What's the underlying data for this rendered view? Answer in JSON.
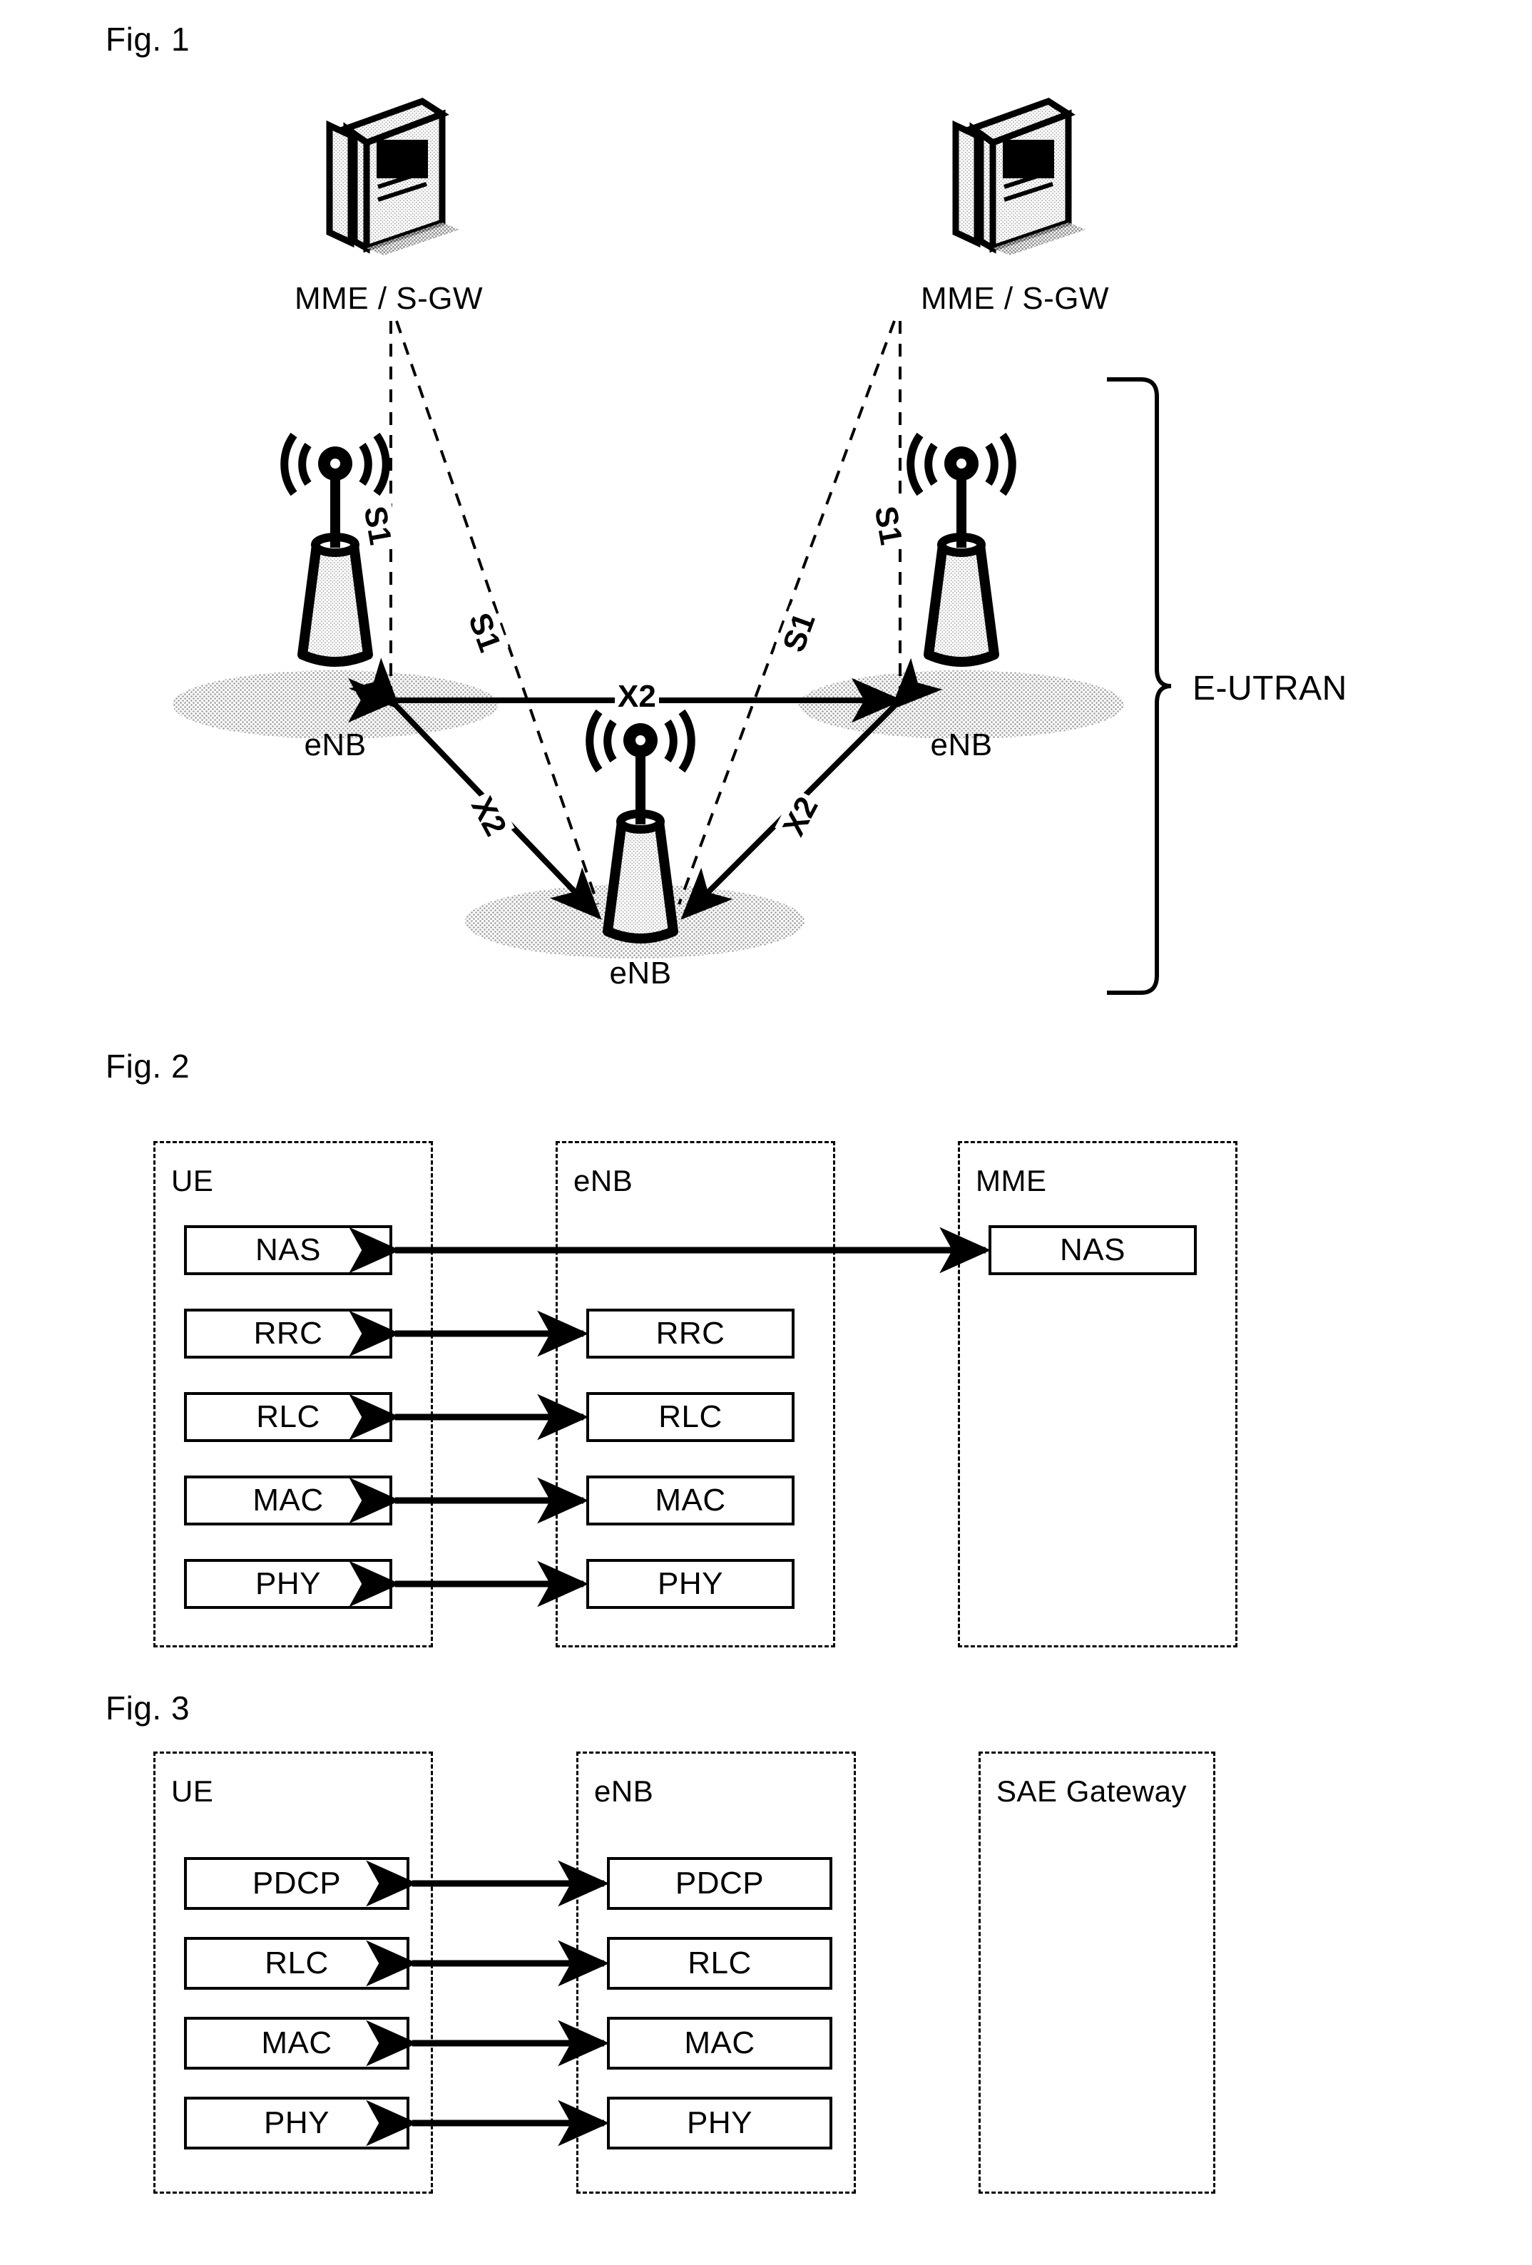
{
  "figures": {
    "fig1": {
      "caption": "Fig. 1",
      "core_nodes": [
        {
          "label": "MME / S-GW"
        },
        {
          "label": "MME / S-GW"
        }
      ],
      "access_nodes": [
        {
          "label": "eNB"
        },
        {
          "label": "eNB"
        },
        {
          "label": "eNB"
        }
      ],
      "interface_labels": {
        "s1_left_vertical": "S1",
        "s1_left_diagonal": "S1",
        "s1_right_vertical": "S1",
        "s1_right_diagonal": "S1",
        "x2_horizontal": "X2",
        "x2_left_diagonal": "X2",
        "x2_right_diagonal": "X2"
      },
      "group_label": "E-UTRAN"
    },
    "fig2": {
      "caption": "Fig. 2",
      "entities": [
        {
          "name": "UE",
          "layers": [
            "NAS",
            "RRC",
            "RLC",
            "MAC",
            "PHY"
          ]
        },
        {
          "name": "eNB",
          "layers": [
            "RRC",
            "RLC",
            "MAC",
            "PHY"
          ]
        },
        {
          "name": "MME",
          "layers": [
            "NAS"
          ]
        }
      ],
      "connections": [
        {
          "from": "UE.NAS",
          "to": "MME.NAS",
          "style": "double-arrow"
        },
        {
          "from": "UE.RRC",
          "to": "eNB.RRC",
          "style": "double-arrow"
        },
        {
          "from": "UE.RLC",
          "to": "eNB.RLC",
          "style": "double-arrow"
        },
        {
          "from": "UE.MAC",
          "to": "eNB.MAC",
          "style": "double-arrow"
        },
        {
          "from": "UE.PHY",
          "to": "eNB.PHY",
          "style": "double-arrow"
        }
      ]
    },
    "fig3": {
      "caption": "Fig. 3",
      "entities": [
        {
          "name": "UE",
          "layers": [
            "PDCP",
            "RLC",
            "MAC",
            "PHY"
          ]
        },
        {
          "name": "eNB",
          "layers": [
            "PDCP",
            "RLC",
            "MAC",
            "PHY"
          ]
        },
        {
          "name": "SAE Gateway",
          "layers": []
        }
      ],
      "connections": [
        {
          "from": "UE.PDCP",
          "to": "eNB.PDCP",
          "style": "double-arrow"
        },
        {
          "from": "UE.RLC",
          "to": "eNB.RLC",
          "style": "double-arrow"
        },
        {
          "from": "UE.MAC",
          "to": "eNB.MAC",
          "style": "double-arrow"
        },
        {
          "from": "UE.PHY",
          "to": "eNB.PHY",
          "style": "double-arrow"
        }
      ]
    }
  },
  "colors": {
    "ink": "#000000",
    "paper": "#ffffff",
    "ground_shadow": "#b8b8b8"
  }
}
